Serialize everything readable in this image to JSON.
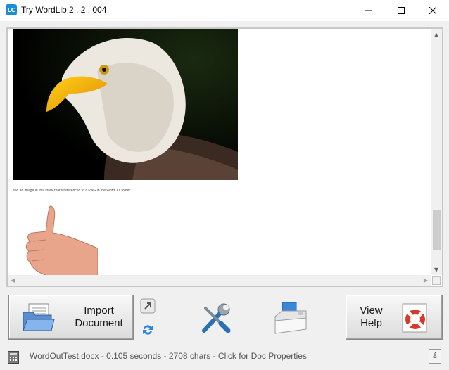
{
  "window": {
    "app_icon_text": "LC",
    "title": "Try WordLib 2 . 2 . 004"
  },
  "document": {
    "caption": "and an image in this stack that's referenced to a PNG in the WordOut folder."
  },
  "buttons": {
    "import_label_line1": "Import",
    "import_label_line2": "Document",
    "help_label_line1": "View",
    "help_label_line2": "Help",
    "font_button": "á"
  },
  "icons": {
    "open_folder": "folder-document-icon",
    "link": "link-arrow-icon",
    "refresh": "refresh-icon",
    "tools": "wrench-screwdriver-icon",
    "print": "printer-icon",
    "help": "lifebuoy-icon",
    "status": "calculator-icon"
  },
  "status": {
    "text": "WordOutTest.docx - 0.105 seconds - 2708 chars - Click for Doc Properties"
  },
  "colors": {
    "accent": "#1b8fd6",
    "window_bg": "#f0f0f0"
  }
}
